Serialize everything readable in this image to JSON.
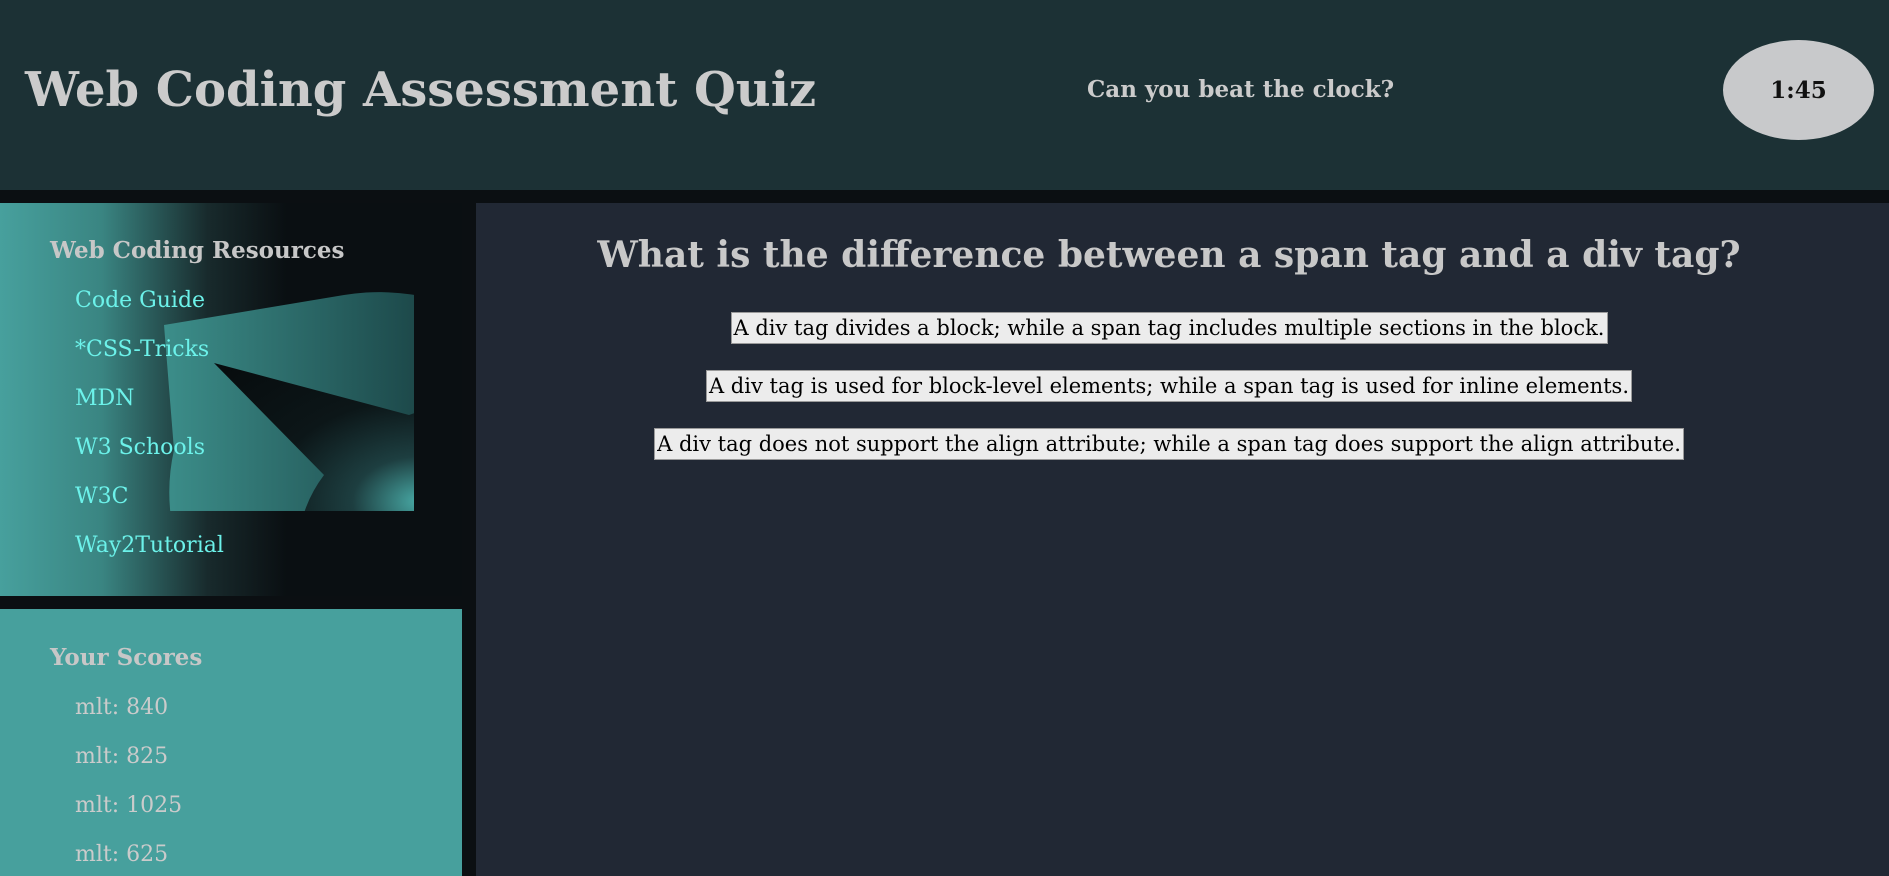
{
  "header": {
    "title": "Web Coding Assessment Quiz",
    "tagline": "Can you beat the clock?",
    "timer": "1:45"
  },
  "resources": {
    "title": "Web Coding Resources",
    "links": [
      "Code Guide",
      "*CSS-Tricks",
      "MDN",
      "W3 Schools",
      "W3C",
      "Way2Tutorial"
    ]
  },
  "scores": {
    "title": "Your Scores",
    "items": [
      "mlt: 840",
      "mlt: 825",
      "mlt: 1025",
      "mlt: 625"
    ]
  },
  "quiz": {
    "question": "What is the difference between a span tag and a div tag?",
    "answers": [
      "A div tag divides a block; while a span tag includes multiple sections in the block.",
      "A div tag is used for block-level elements; while a span tag is used for inline elements.",
      "A div tag does not support the align attribute; while a span tag does support the align attribute."
    ]
  },
  "colors": {
    "header_bg": "#1c3135",
    "main_bg": "#212834",
    "teal": "#47a09d",
    "link": "#6cf2ea",
    "timer_bg": "#c8c9cb"
  }
}
